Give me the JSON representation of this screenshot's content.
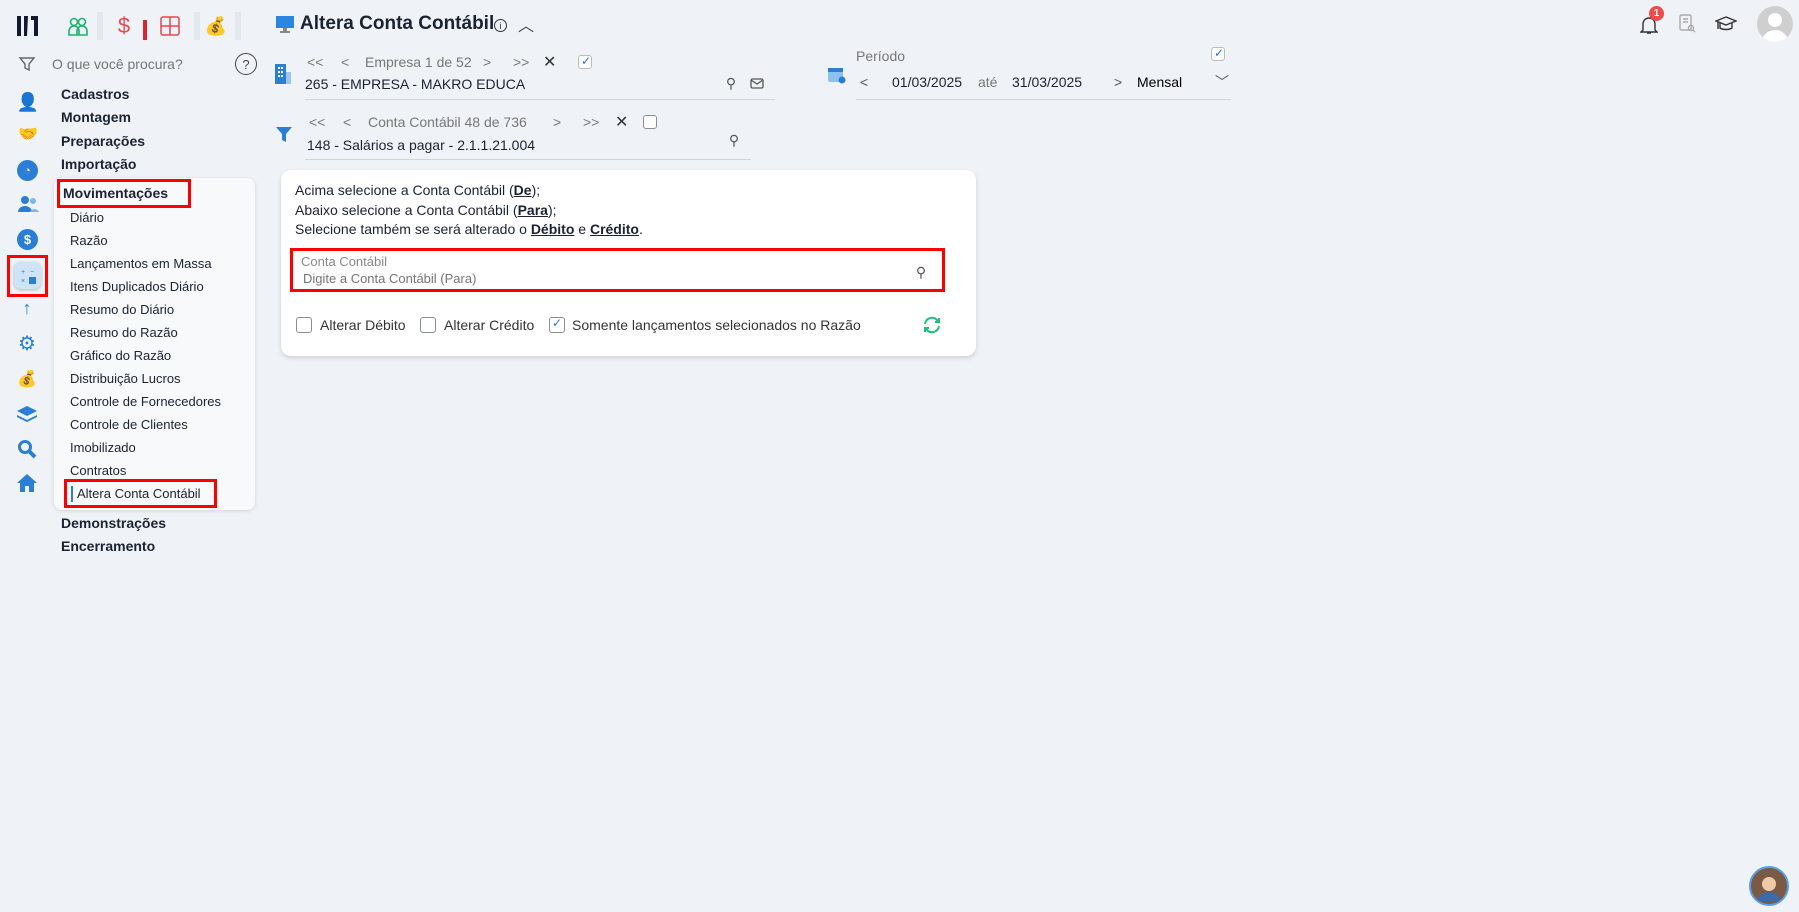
{
  "header": {
    "title": "Altera Conta Contábil",
    "notification_count": "1"
  },
  "search": {
    "placeholder": "O que você procura?"
  },
  "menu": {
    "sections_top": [
      "Cadastros",
      "Montagem",
      "Preparações",
      "Importação"
    ],
    "active_section": "Movimentações",
    "items": [
      "Diário",
      "Razão",
      "Lançamentos em Massa",
      "Itens Duplicados Diário",
      "Resumo do Diário",
      "Resumo do Razão",
      "Gráfico do Razão",
      "Distribuição Lucros",
      "Controle de Fornecedores",
      "Controle de Clientes",
      "Imobilizado",
      "Contratos"
    ],
    "active_item": "Altera Conta Contábil",
    "sections_bottom": [
      "Demonstrações",
      "Encerramento"
    ]
  },
  "empresa": {
    "nav_label": "Empresa 1 de 52",
    "value": "265 - EMPRESA - MAKRO EDUCA",
    "checked": true
  },
  "conta": {
    "nav_label": "Conta Contábil 48 de 736",
    "value": "148 - Salários a pagar - 2.1.1.21.004",
    "checked": false
  },
  "periodo": {
    "label": "Período",
    "start": "01/03/2025",
    "sep": "até",
    "end": "31/03/2025",
    "mode": "Mensal"
  },
  "card": {
    "line1_a": "Acima selecione a Conta Contábil (",
    "line1_b": "De",
    "line1_c": ");",
    "line2_a": "Abaixo selecione a Conta Contábil (",
    "line2_b": "Para",
    "line2_c": ");",
    "line3_a": "Selecione também se será alterado o ",
    "line3_b": "Débito",
    "line3_c": " e ",
    "line3_d": "Crédito",
    "line3_e": ".",
    "input_label": "Conta Contábil",
    "input_placeholder": "Digite a Conta Contábil (Para)",
    "cb_debito": "Alterar Débito",
    "cb_credito": "Alterar Crédito",
    "cb_somente": "Somente lançamentos selecionados no Razão"
  },
  "colors": {
    "accent": "#2a7fd4",
    "highlight": "#ff0000",
    "refresh": "#1fbf7a"
  }
}
